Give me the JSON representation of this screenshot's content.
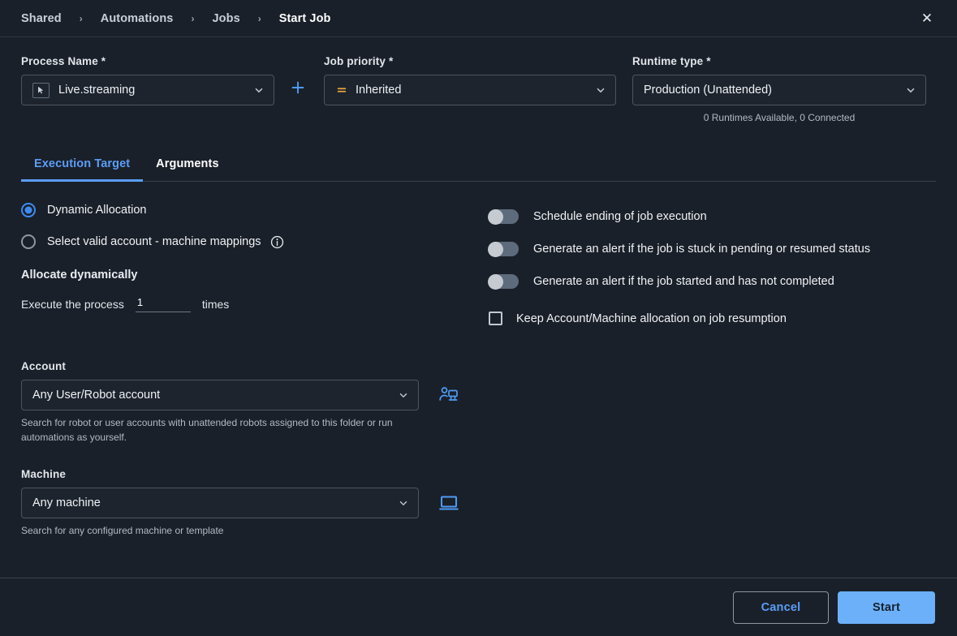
{
  "header": {
    "breadcrumb": [
      {
        "label": "Shared"
      },
      {
        "label": "Automations"
      },
      {
        "label": "Jobs"
      },
      {
        "label": "Start Job"
      }
    ],
    "separator": "›",
    "close_label": "✕"
  },
  "form": {
    "process": {
      "label": "Process Name *",
      "value": "Live.streaming",
      "icon": "cursor-pointer-icon",
      "add_label": "+"
    },
    "priority": {
      "label": "Job priority *",
      "value": "Inherited",
      "icon": "equals-priority-icon",
      "icon_color": "#e8a33d"
    },
    "runtime": {
      "label": "Runtime type *",
      "value": "Production (Unattended)",
      "status": "0 Runtimes Available, 0 Connected"
    }
  },
  "tabs": [
    {
      "label": "Execution Target",
      "active": true
    },
    {
      "label": "Arguments",
      "active": false
    }
  ],
  "execution_target": {
    "allocation_options": [
      {
        "label": "Dynamic Allocation",
        "selected": true,
        "info": false
      },
      {
        "label": "Select valid account - machine mappings",
        "selected": false,
        "info": true
      }
    ],
    "allocate_heading": "Allocate dynamically",
    "execute_prefix": "Execute the process",
    "execute_count": "1",
    "execute_suffix": "times",
    "toggles": [
      {
        "label": "Schedule ending of job execution",
        "on": false
      },
      {
        "label": "Generate an alert if the job is stuck in pending or resumed status",
        "on": false
      },
      {
        "label": "Generate an alert if the job started and has not completed",
        "on": false
      }
    ],
    "checkbox": {
      "label": "Keep Account/Machine allocation on job resumption",
      "checked": false
    },
    "account": {
      "label": "Account",
      "value": "Any User/Robot account",
      "helper": "Search for robot or user accounts with unattended robots assigned to this folder or run automations as yourself.",
      "icon": "user-robot-icon"
    },
    "machine": {
      "label": "Machine",
      "value": "Any machine",
      "helper": "Search for any configured machine or template",
      "icon": "monitor-icon"
    }
  },
  "footer": {
    "cancel_label": "Cancel",
    "start_label": "Start"
  },
  "colors": {
    "background": "#1a2029",
    "accent_blue": "#5b9df7",
    "primary_button": "#6cb0fa",
    "priority_orange": "#e8a33d",
    "border": "#39424f"
  }
}
